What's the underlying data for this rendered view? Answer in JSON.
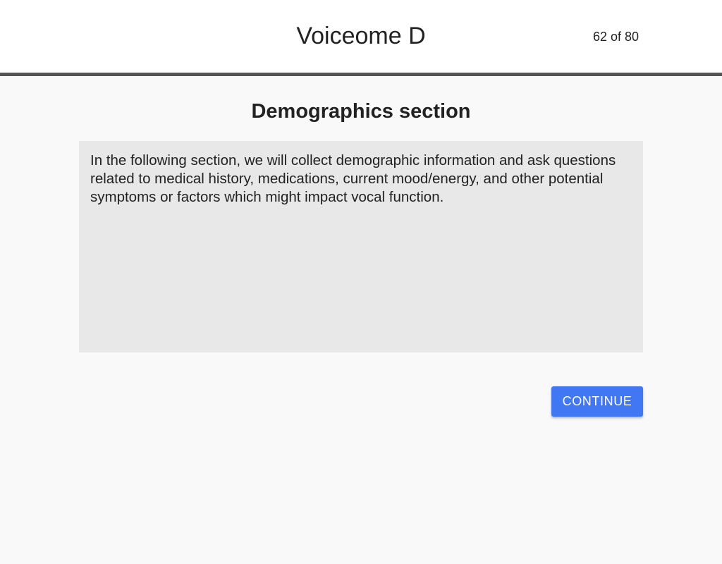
{
  "header": {
    "title": "Voiceome D",
    "progress": "62 of 80"
  },
  "section": {
    "title": "Demographics section",
    "description": "In the following section, we will collect demographic information and ask questions related to medical history, medications, current mood/energy, and other potential symptoms or factors which might impact vocal function."
  },
  "actions": {
    "continue_label": "CONTINUE"
  },
  "colors": {
    "header_background": "#ffffff",
    "header_border": "#555555",
    "page_background": "#f9f9f9",
    "panel_background": "#e8e8e8",
    "button_background": "#4277f4",
    "button_text": "#ffffff"
  }
}
